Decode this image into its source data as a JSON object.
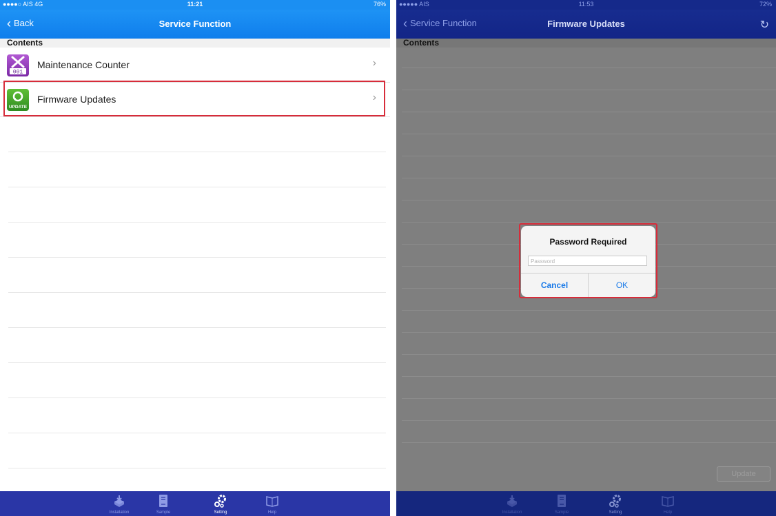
{
  "left": {
    "status": {
      "carrier": "●●●●○ AIS  4G",
      "time": "11:21",
      "battery": "76%"
    },
    "nav": {
      "back": "Back",
      "title": "Service Function"
    },
    "section": "Contents",
    "rows": [
      {
        "label": "Maintenance Counter"
      },
      {
        "label": "Firmware Updates"
      }
    ],
    "icon_text": {
      "counter": "001",
      "update": "UPDATE"
    }
  },
  "right": {
    "status": {
      "carrier": "●●●●● AIS",
      "time": "11:53",
      "battery": "72%"
    },
    "nav": {
      "back": "Service Function",
      "title": "Firmware Updates"
    },
    "section": "Contents",
    "dialog": {
      "title": "Password Required",
      "placeholder": "Password",
      "cancel": "Cancel",
      "ok": "OK"
    },
    "update_button": "Update"
  },
  "tabs": [
    {
      "label": "Installation",
      "icon": "installation-icon"
    },
    {
      "label": "Sample",
      "icon": "sample-icon"
    },
    {
      "label": "Setting",
      "icon": "setting-icon"
    },
    {
      "label": "Help",
      "icon": "help-icon"
    }
  ],
  "colors": {
    "accent": "#1b8ff2",
    "highlight": "#d72c3a",
    "tabbar": "#2a36a6"
  }
}
